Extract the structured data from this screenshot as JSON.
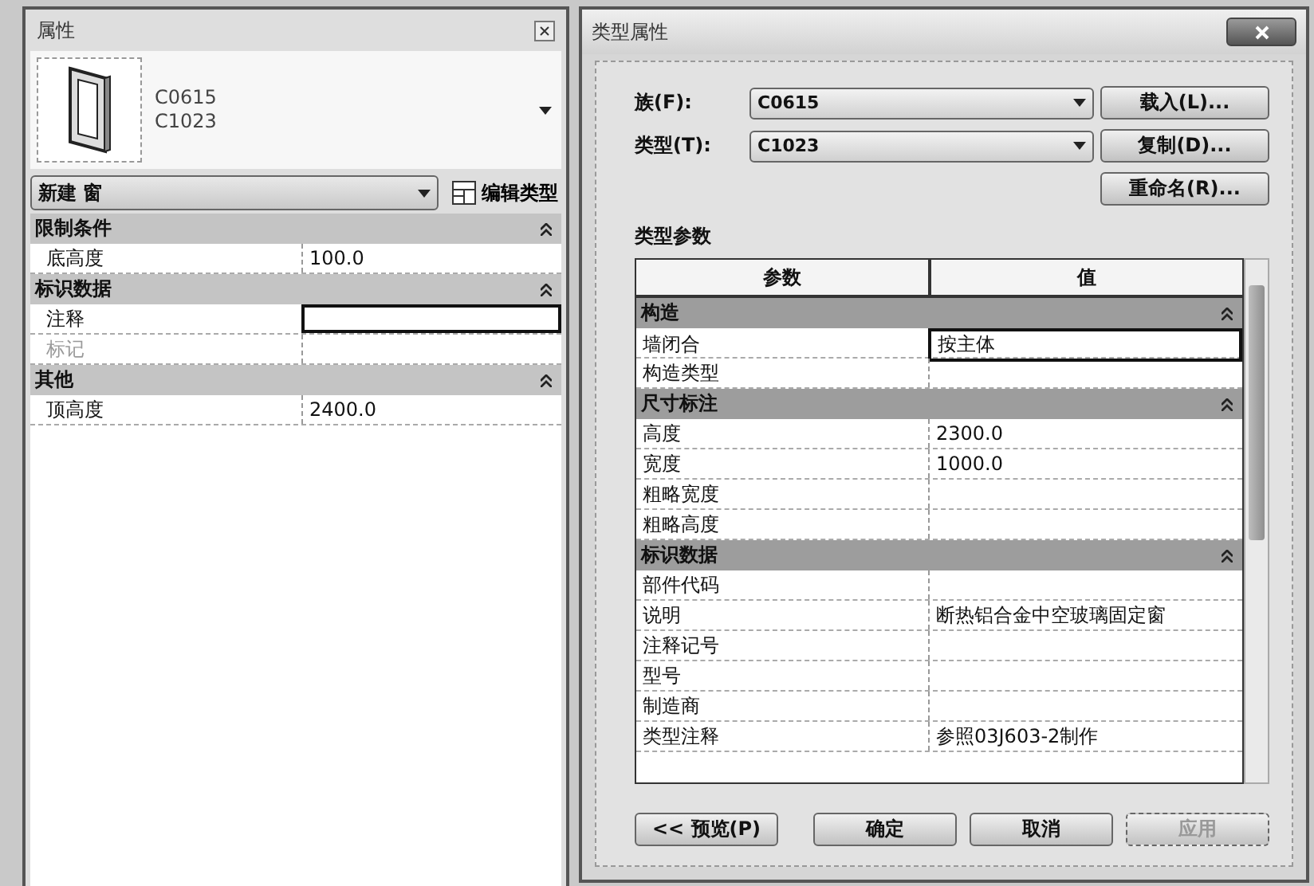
{
  "properties_panel": {
    "title": "属性",
    "preview": {
      "lines": [
        "C0615",
        "C1023"
      ]
    },
    "type_selector": "新建 窗",
    "edit_type_button": "编辑类型",
    "groups": [
      {
        "name": "限制条件",
        "expanded": true,
        "rows": [
          {
            "name": "底高度",
            "value": "100.0",
            "editing": false,
            "disabled": false
          }
        ]
      },
      {
        "name": "标识数据",
        "expanded": true,
        "rows": [
          {
            "name": "注释",
            "value": "",
            "editing": true,
            "disabled": false
          },
          {
            "name": "标记",
            "value": "",
            "editing": false,
            "disabled": true
          }
        ]
      },
      {
        "name": "其他",
        "expanded": true,
        "rows": [
          {
            "name": "顶高度",
            "value": "2400.0",
            "editing": false,
            "disabled": false
          }
        ]
      }
    ]
  },
  "type_dialog": {
    "title": "类型属性",
    "fields": [
      {
        "label": "族(F):",
        "value": "C0615",
        "button": "载入(L)..."
      },
      {
        "label": "类型(T):",
        "value": "C1023",
        "button": "复制(D)..."
      }
    ],
    "rename_button": "重命名(R)...",
    "section_label": "类型参数",
    "columns": [
      "参数",
      "值"
    ],
    "groups": [
      {
        "name": "构造",
        "expanded": true,
        "rows": [
          {
            "name": "墙闭合",
            "value": "按主体",
            "editing": true
          },
          {
            "name": "构造类型",
            "value": "",
            "editing": false
          }
        ]
      },
      {
        "name": "尺寸标注",
        "expanded": true,
        "rows": [
          {
            "name": "高度",
            "value": "2300.0",
            "editing": false
          },
          {
            "name": "宽度",
            "value": "1000.0",
            "editing": false
          },
          {
            "name": "粗略宽度",
            "value": "",
            "editing": false
          },
          {
            "name": "粗略高度",
            "value": "",
            "editing": false
          }
        ]
      },
      {
        "name": "标识数据",
        "expanded": true,
        "rows": [
          {
            "name": "部件代码",
            "value": "",
            "editing": false
          },
          {
            "name": "说明",
            "value": "断热铝合金中空玻璃固定窗",
            "editing": false
          },
          {
            "name": "注释记号",
            "value": "",
            "editing": false
          },
          {
            "name": "型号",
            "value": "",
            "editing": false
          },
          {
            "name": "制造商",
            "value": "",
            "editing": false
          },
          {
            "name": "类型注释",
            "value": "参照03J603-2制作",
            "editing": false
          }
        ]
      }
    ],
    "buttons": [
      {
        "label": "<< 预览(P)",
        "disabled": false
      },
      {
        "label": "确定",
        "disabled": false
      },
      {
        "label": "取消",
        "disabled": false
      },
      {
        "label": "应用",
        "disabled": true
      }
    ]
  }
}
